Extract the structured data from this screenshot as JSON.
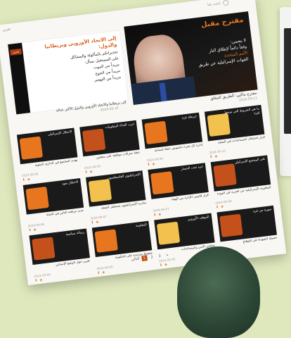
{
  "topbar": {
    "menu_label": "تحرير",
    "search_label": "ابحث هنا"
  },
  "hero": {
    "headline": "مقترح مقبل",
    "lines": [
      {
        "text": "لا يضمن:",
        "orange": false
      },
      {
        "text": "وقفاً دائماً لإطلاق النار",
        "orange": false
      },
      {
        "text": "الأمم المتحدة",
        "orange": true
      },
      {
        "text": "القوات الإسرائيلية عن طريق",
        "orange": false
      }
    ],
    "caption": "مقترح ماكين: الطريق المغلق",
    "date": "2024-09-11"
  },
  "side": {
    "title": "إلى الاتحاد الأوروبي وبريطانيا والدول:",
    "body": [
      "تحذيراتكم بالمأكولة والمشاكل",
      "على المستقبل نسأل:",
      "مزيداً من الموت",
      "مزيداً من الجوع",
      "مزيداً من التهجير"
    ],
    "caption": "إلى بريطانيا والاتحاد الأوروبي والدول الأكثر عدالة",
    "date": "2024-09-10",
    "logo": "تحرير"
  },
  "cards": [
    {
      "thumb_title": "ما هي الشروط التي تمنعها لغزة",
      "caption": "قرار استئناف المساعدات في الضفة",
      "date": "2024-09-10",
      "accent": "#f2c14e"
    },
    {
      "thumb_title": "خريطة غزة",
      "caption": "إدارة كل شيء بخصوص خطة إنسانية",
      "date": "2024-09-09",
      "accent": "#e8761f"
    },
    {
      "thumb_title": "حرب الغذاء المعلومات",
      "caption": "خطة جنرالات موافقة على مجلس",
      "date": "2024-09-09",
      "accent": "#c4511b"
    },
    {
      "thumb_title": "الاحتلال الإسرائيلي",
      "caption": "تهديد المجتمع في الذكرى المئوية",
      "date": "2024-09-08",
      "accent": "#e8761f"
    },
    {
      "thumb_title": "على المجتمع الإسرائيلي",
      "caption": "المقاومة الإسرائيلية عن الحرية في العودة",
      "date": "2024-09-08",
      "accent": "#c4511b"
    },
    {
      "thumb_title": "غزة تحت الحصار",
      "caption": "قرار قانوني الإدارة من الهيئة",
      "date": "2024-09-07",
      "accent": "#e8761f"
    },
    {
      "thumb_title": "الإسرائيليون الفلسطينيون",
      "caption": "مبادرة الإسرائيليون مستقبل الضفة",
      "date": "2024-09-07",
      "accent": "#f2c14e"
    },
    {
      "thumb_title": "الاحتلال يعود",
      "caption": "جديد مراقبة التأثير في الحياة",
      "date": "2024-09-06",
      "accent": "#e8761f"
    },
    {
      "thumb_title": "صورة من غزة",
      "caption": "حصيلة الشهداء في القطاع",
      "date": "2024-09-06",
      "accent": "#c4511b"
    },
    {
      "thumb_title": "الموقف الأوروبي",
      "caption": "مجلس الأمن والمساعدات",
      "date": "2024-09-05",
      "accent": "#f2c14e"
    },
    {
      "thumb_title": "المقاومة",
      "caption": "ضغوط متزايدة على الحكومة",
      "date": "2024-09-05",
      "accent": "#e8761f"
    },
    {
      "thumb_title": "رسالة سياسية",
      "caption": "تقرير حول الوضع الإنساني",
      "date": "2024-09-04",
      "accent": "#c4511b"
    }
  ],
  "pagination": {
    "pages": [
      "التالي",
      "1",
      "2",
      "3",
      "»"
    ],
    "active_index": 1
  }
}
